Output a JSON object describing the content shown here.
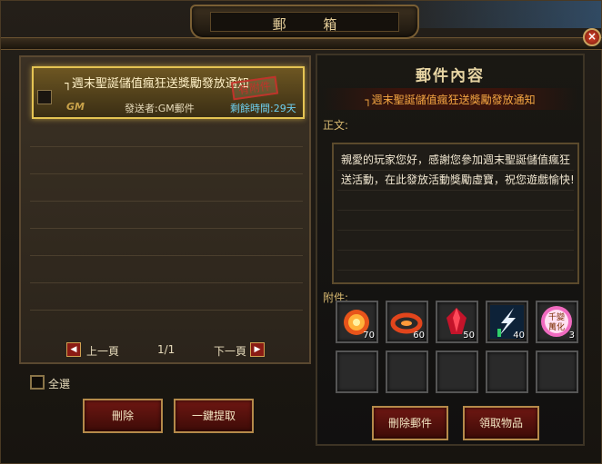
{
  "window": {
    "title": "郵 箱",
    "close_label": "×"
  },
  "mail_list": {
    "items": [
      {
        "subject": "┐週末聖誕儲值瘋狂送獎勵發放通知",
        "logo": "GM",
        "sender": "發送者:GM郵件",
        "remaining": "剩餘時間:29天",
        "stamp": "有附件"
      }
    ],
    "pager": {
      "prev_label": "上一頁",
      "page": "1/1",
      "next_label": "下一頁"
    },
    "select_all_label": "全選",
    "delete_label": "刪除",
    "claim_all_label": "一鍵提取"
  },
  "mail_content": {
    "title": "郵件內容",
    "subject": "┐週末聖誕儲值瘋狂送獎勵發放通知",
    "body_label": "正文:",
    "body": "親愛的玩家您好，感謝您參加週末聖誕儲值瘋狂送活動，在此發放活動獎勵虛寶，祝您遊戲愉快!",
    "attachments_label": "附件:",
    "attachments": [
      {
        "icon": "fire-orb-icon",
        "qty": "70"
      },
      {
        "icon": "flame-ring-icon",
        "qty": "60"
      },
      {
        "icon": "red-crystal-icon",
        "qty": "50"
      },
      {
        "icon": "lightning-feather-icon",
        "qty": "40"
      },
      {
        "icon": "thousand-transform-icon",
        "qty": "3",
        "label": "千變\n萬化"
      }
    ],
    "delete_mail_label": "刪除郵件",
    "claim_items_label": "領取物品"
  }
}
